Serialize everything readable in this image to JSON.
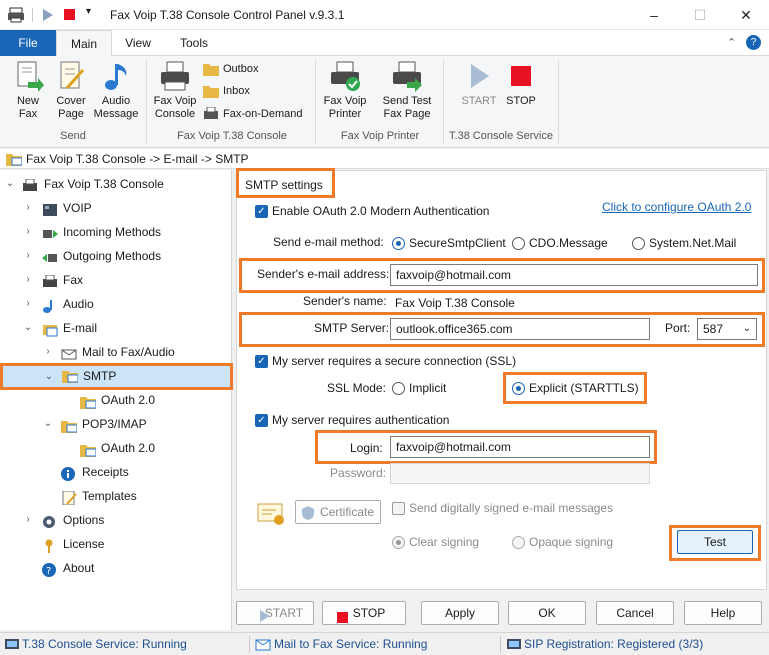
{
  "window": {
    "title": "Fax Voip T.38 Console Control Panel v.9.3.1"
  },
  "ribbon_tabs": [
    "File",
    "Main",
    "View",
    "Tools"
  ],
  "ribbon": {
    "send": {
      "new_fax": [
        "New",
        "Fax"
      ],
      "cover_page": [
        "Cover",
        "Page"
      ],
      "audio_message": [
        "Audio",
        "Message"
      ],
      "group": "Send"
    },
    "console": {
      "fax_voip_console": [
        "Fax Voip",
        "Console"
      ],
      "outbox": "Outbox",
      "inbox": "Inbox",
      "fax_on_demand": "Fax-on-Demand",
      "group": "Fax Voip T.38 Console"
    },
    "printer": {
      "fax_voip_printer": [
        "Fax Voip",
        "Printer"
      ],
      "send_test": [
        "Send Test",
        "Fax Page"
      ],
      "group": "Fax Voip Printer"
    },
    "service": {
      "start": "START",
      "stop": "STOP",
      "group": "T.38 Console Service"
    }
  },
  "breadcrumb": "Fax Voip T.38 Console -> E-mail -> SMTP",
  "tree": {
    "root": "Fax Voip T.38 Console",
    "voip": "VOIP",
    "incoming": "Incoming Methods",
    "outgoing": "Outgoing Methods",
    "fax": "Fax",
    "audio": "Audio",
    "email": "E-mail",
    "mail_to_fax": "Mail to Fax/Audio",
    "smtp": "SMTP",
    "smtp_oauth": "OAuth 2.0",
    "pop3": "POP3/IMAP",
    "pop3_oauth": "OAuth 2.0",
    "receipts": "Receipts",
    "templates": "Templates",
    "options": "Options",
    "license": "License",
    "about": "About"
  },
  "smtp": {
    "section_title": "SMTP settings",
    "oauth_checkbox": "Enable OAuth 2.0 Modern Authentication",
    "oauth_link": "Click to configure OAuth 2.0",
    "send_method_label": "Send e-mail method:",
    "send_methods": [
      "SecureSmtpClient",
      "CDO.Message",
      "System.Net.Mail"
    ],
    "sender_address_label": "Sender's e-mail address:",
    "sender_address_value": "faxvoip@hotmail.com",
    "sender_name_label": "Sender's name:",
    "sender_name_value": "Fax Voip T.38 Console",
    "server_label": "SMTP Server:",
    "server_value": "outlook.office365.com",
    "port_label": "Port:",
    "port_value": "587",
    "ssl_checkbox": "My server requires a secure connection (SSL)",
    "ssl_mode_label": "SSL Mode:",
    "ssl_modes": [
      "Implicit",
      "Explicit (STARTTLS)"
    ],
    "auth_checkbox": "My server requires authentication",
    "login_label": "Login:",
    "login_value": "faxvoip@hotmail.com",
    "password_label": "Password:",
    "certificate_button": "Certificate",
    "sign_checkbox": "Send digitally signed e-mail messages",
    "signing_modes": [
      "Clear signing",
      "Opaque signing"
    ],
    "test_button": "Test"
  },
  "bottom_buttons": {
    "start": "START",
    "stop": "STOP",
    "apply": "Apply",
    "ok": "OK",
    "cancel": "Cancel",
    "help": "Help"
  },
  "status": {
    "t38": "T.38 Console Service: Running",
    "mail": "Mail to Fax Service: Running",
    "sip": "SIP Registration: Registered (3/3)"
  },
  "colors": {
    "accent": "#1966b7",
    "highlight": "#ef7b2a",
    "selection": "#cce4f7",
    "stop_red": "#e81123"
  }
}
